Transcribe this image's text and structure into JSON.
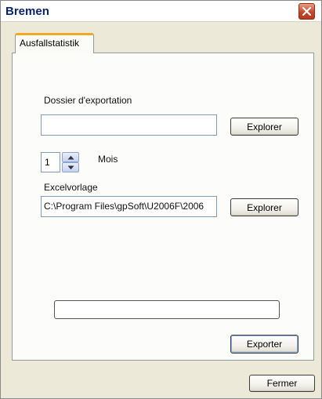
{
  "window": {
    "title": "Bremen"
  },
  "tabs": [
    {
      "label": "Ausfallstatistik",
      "active": true
    }
  ],
  "export_folder": {
    "label": "Dossier d'exportation",
    "value": "",
    "browse_label": "Explorer"
  },
  "months": {
    "value": "1",
    "label": "Mois"
  },
  "excel_template": {
    "label": "Excelvorlage",
    "value": "C:\\Program Files\\gpSoft\\U2006F\\2006",
    "browse_label": "Explorer"
  },
  "progress": {
    "value": ""
  },
  "export_button": "Exporter",
  "close_button": "Fermer",
  "icons": {
    "close": "close-icon",
    "spin_up": "arrow-up-icon",
    "spin_down": "arrow-down-icon"
  },
  "colors": {
    "title_text": "#0a246a",
    "tab_highlight": "#f5a623",
    "close_button": "#c8452a"
  }
}
